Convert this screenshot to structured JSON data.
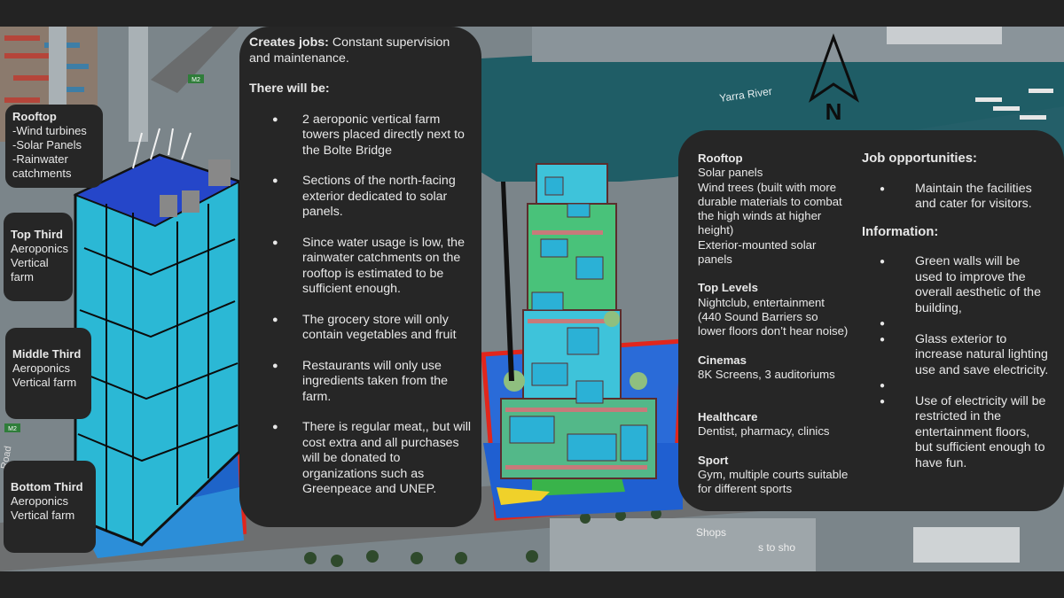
{
  "map": {
    "river_label": "Yarra River",
    "compass_letter": "N",
    "road_badges": [
      "M2",
      "M2"
    ],
    "road_side_text": "Road",
    "hidden_text": "Shops",
    "hidden_text_2": "s to sho"
  },
  "left_labels": [
    {
      "title": "Rooftop",
      "lines": [
        "-Wind turbines",
        "-Solar Panels",
        "-Rainwater",
        "catchments"
      ]
    },
    {
      "title": "Top Third",
      "lines": [
        "Aeroponics",
        "Vertical",
        "farm"
      ]
    },
    {
      "title": "Middle Third",
      "lines": [
        "Aeroponics",
        "Vertical farm"
      ]
    },
    {
      "title": "Bottom Third",
      "lines": [
        "Aeroponics",
        "Vertical farm"
      ]
    }
  ],
  "middle": {
    "jobs_bold": "Creates jobs:",
    "jobs_text": " Constant supervision and maintenance.",
    "heading": "There will be:",
    "bullets": [
      " 2 aeroponic vertical farm towers placed directly next to the Bolte Bridge",
      "Sections of the north-facing exterior dedicated to solar panels.",
      "Since water usage is low, the rainwater catchments on the rooftop is estimated to be sufficient enough.",
      "The grocery store will only contain vegetables and fruit",
      "Restaurants  will only use ingredients taken from the farm.",
      "There is regular meat,, but will cost  extra  and all purchases  will be donated to organizations such as Greenpeace  and UNEP."
    ]
  },
  "right": {
    "sections": [
      {
        "title": "Rooftop",
        "text": [
          "Solar panels",
          "Wind trees (built with more durable materials to combat the high winds at higher height)",
          "Exterior-mounted solar panels"
        ]
      },
      {
        "title": "Top Levels",
        "text": [
          "Nightclub, entertainment (440 Sound Barriers so lower floors don’t hear noise)"
        ]
      },
      {
        "title": "Cinemas",
        "text": [
          "8K Screens, 3 auditoriums"
        ]
      },
      {
        "title": "Healthcare",
        "text": [
          "Dentist, pharmacy, clinics"
        ]
      },
      {
        "title": "Sport",
        "text": [
          "Gym, multiple courts suitable for different sports"
        ]
      }
    ],
    "job_title": "Job opportunities:",
    "job_items": [
      "Maintain the facilities and cater for visitors."
    ],
    "info_title": "Information:",
    "info_items": [
      "Green walls will be used to improve the overall aesthetic of the building,",
      "",
      "Glass exterior to increase natural lighting use and save electricity.",
      "",
      "Use of electricity will be restricted in the entertainment floors, but sufficient enough to have fun."
    ]
  },
  "colors": {
    "water": "#1f5d66",
    "panel": "#262626",
    "tower_cyan": "#3ec3da",
    "red_outline": "#e1261c",
    "blue_plaza": "#1f5fd1"
  }
}
